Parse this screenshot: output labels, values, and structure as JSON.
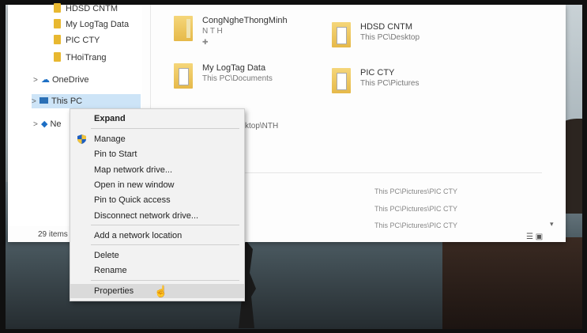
{
  "nav": {
    "items": [
      {
        "label": "HDSD CNTM"
      },
      {
        "label": "My LogTag Data"
      },
      {
        "label": "PIC CTY"
      },
      {
        "label": "THoiTrang"
      }
    ],
    "onedrive": "OneDrive",
    "this_pc": "This PC",
    "network": "Ne"
  },
  "tiles": [
    {
      "name": "CongNgheThongMinh",
      "sub": "N T H"
    },
    {
      "name": "HDSD CNTM",
      "sub": "This PC\\Desktop"
    },
    {
      "name": "My LogTag Data",
      "sub": "This PC\\Documents"
    },
    {
      "name": "PIC CTY",
      "sub": "This PC\\Pictures"
    }
  ],
  "partial": {
    "a": "ktop\\NTH"
  },
  "recent_paths": [
    "This PC\\Pictures\\PIC CTY",
    "This PC\\Pictures\\PIC CTY",
    "This PC\\Pictures\\PIC CTY"
  ],
  "status": {
    "count": "29 items"
  },
  "context_menu": {
    "expand": "Expand",
    "manage": "Manage",
    "pin_start": "Pin to Start",
    "map_drive": "Map network drive...",
    "open_window": "Open in new window",
    "pin_quick": "Pin to Quick access",
    "disconnect": "Disconnect network drive...",
    "add_location": "Add a network location",
    "delete": "Delete",
    "rename": "Rename",
    "properties": "Properties"
  },
  "colors": {
    "selection": "#cde4f7",
    "folder": "#e6b949",
    "menu_bg": "#f2f2f2"
  }
}
